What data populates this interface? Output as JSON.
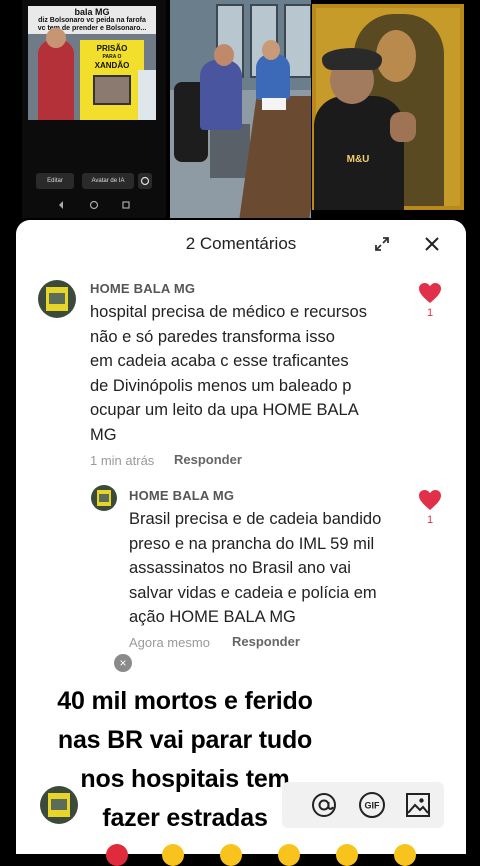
{
  "video": {
    "caption_title": "bala MG",
    "caption_line1": "diz Bolsonaro vc peida na farofa",
    "caption_line2": "vc tem de prender e Bolsonaro...",
    "sign_line1": "PRISÃO",
    "sign_line2": "PARA O",
    "sign_line3": "XANDÃO",
    "edit_label": "Editar",
    "ai_label": "Avatar de IA",
    "shirt_logo": "M&U"
  },
  "sheet": {
    "title": "2 Comentários"
  },
  "comments": [
    {
      "username": "HOME BALA MG",
      "text_lines": [
        "hospital precisa de médico e recursos",
        "não e só paredes  transforma isso",
        "em cadeia acaba c esse traficantes",
        "de Divinópolis menos um baleado p",
        "ocupar um leito da upa HOME BALA",
        "MG"
      ],
      "time": "1 min atrás",
      "reply_label": "Responder",
      "likes": "1"
    },
    {
      "username": "HOME BALA MG",
      "text_lines": [
        "Brasil precisa e de cadeia bandido",
        "preso e na prancha do IML 59 mil",
        "assassinatos no Brasil ano  vai",
        "salvar vidas e cadeia e polícia em",
        "ação HOME BALA MG"
      ],
      "time": "Agora mesmo",
      "reply_label": "Responder",
      "likes": "1"
    }
  ],
  "draft": {
    "dismiss_symbol": "×",
    "lines": [
      "40 mil mortos e ferido",
      "nas BR vai parar tudo",
      "nos hospitais tem",
      "fazer estradas"
    ]
  },
  "input_bar": {
    "icons": [
      "at-icon",
      "gif-icon",
      "image-icon"
    ],
    "gif_label": "GIF",
    "at_label": "@"
  },
  "colors": {
    "heart": "#e0304a",
    "sheet_bg": "#ffffff",
    "screen_bg": "#000000"
  }
}
